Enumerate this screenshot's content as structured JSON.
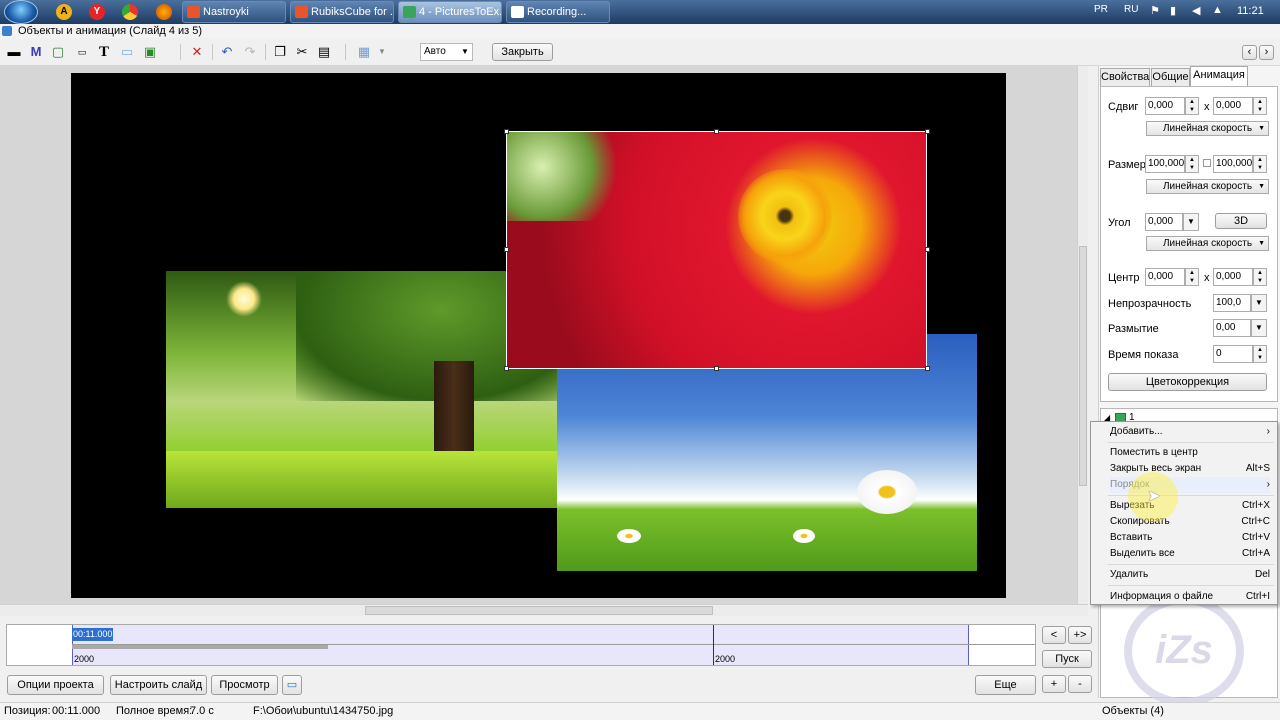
{
  "taskbar": {
    "tasks": [
      {
        "label": "Nastroyki",
        "color": "#e8542c"
      },
      {
        "label": "RubiksCube for ...",
        "color": "#e8542c"
      },
      {
        "label": "4 - PicturesToEx...",
        "color": "#3aa55a"
      },
      {
        "label": "Recording...",
        "color": "#ffffff"
      }
    ],
    "lang1": "PR",
    "lang2": "RU",
    "clock": "11:21"
  },
  "window": {
    "title": "Объекты и анимация  (Слайд 4 из 5)"
  },
  "toolbar": {
    "mode_value": "Авто",
    "close_label": "Закрыть",
    "prev_arrow": "‹",
    "next_arrow": "›"
  },
  "panel": {
    "tabs": [
      "Свойства",
      "Общие",
      "Анимация"
    ],
    "shift_label": "Сдвиг",
    "shift_x": "0,000",
    "shift_y": "0,000",
    "x_sep": "x",
    "speed_label": "Линейная скорость",
    "size_label": "Размер",
    "size_w": "100,000",
    "size_h": "100,000",
    "angle_label": "Угол",
    "angle_value": "0,000",
    "btn_3d": "3D",
    "center_label": "Центр",
    "center_x": "0,000",
    "center_y": "0,000",
    "opacity_label": "Непрозрачность",
    "opacity_value": "100,0",
    "blur_label": "Размытие",
    "blur_value": "0,00",
    "showtime_label": "Время показа",
    "showtime_value": "0",
    "colorcorr_label": "Цветокоррекция",
    "tree_item": "1"
  },
  "context_menu": {
    "items": [
      {
        "label": "Добавить...",
        "shortcut": "",
        "submenu": "›"
      },
      {
        "label": "Поместить в центр",
        "shortcut": ""
      },
      {
        "label": "Закрыть весь экран",
        "shortcut": "Alt+S"
      },
      {
        "label": "Порядок",
        "shortcut": "",
        "submenu": "›"
      },
      {
        "label": "Вырезать",
        "shortcut": "Ctrl+X"
      },
      {
        "label": "Скопировать",
        "shortcut": "Ctrl+C"
      },
      {
        "label": "Вставить",
        "shortcut": "Ctrl+V"
      },
      {
        "label": "Выделить все",
        "shortcut": "Ctrl+A"
      },
      {
        "label": "Удалить",
        "shortcut": "Del"
      },
      {
        "label": "Информация о файле",
        "shortcut": "Ctrl+I"
      }
    ]
  },
  "timeline": {
    "time_marker": "00:11.000",
    "tick1": "2000",
    "tick2": "2000",
    "prev_btn": "<",
    "next_btn": "+>",
    "play_btn": "Пуск"
  },
  "bottom": {
    "project_options": "Опции проекта",
    "slide_setup": "Настроить слайд",
    "preview": "Просмотр",
    "more": "Еще",
    "plus": "+",
    "minus": "-"
  },
  "status": {
    "position_label": "Позиция:",
    "position_value": "00:11.000",
    "total_label": "Полное время:",
    "total_value": "7.0 с",
    "file_path": "F:\\Обои\\ubuntu\\1434750.jpg",
    "objects": "Объекты (4)"
  },
  "colors": {
    "tree_green": "#6fcf2a",
    "flower_red": "#e0162e",
    "sky_blue": "#2f6fd0"
  }
}
